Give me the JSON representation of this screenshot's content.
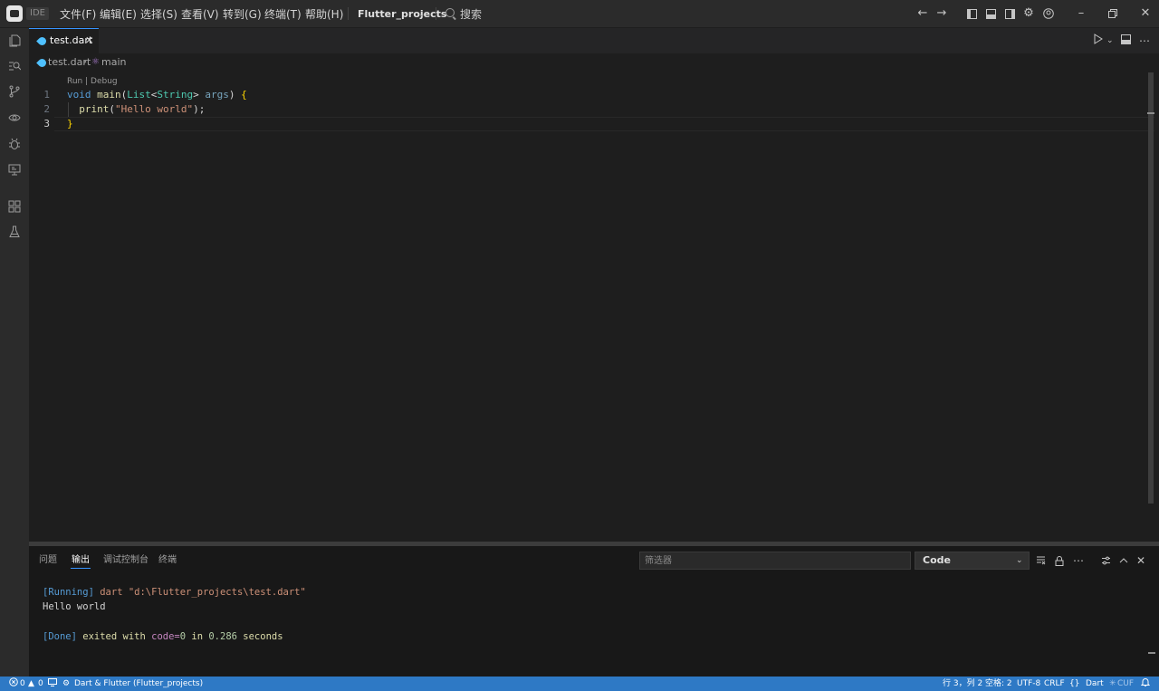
{
  "titlebar": {
    "ide_badge": "IDE",
    "menus": [
      "文件(F)",
      "编辑(E)",
      "选择(S)",
      "查看(V)",
      "转到(G)",
      "终端(T)",
      "帮助(H)"
    ],
    "project": "Flutter_projects",
    "search_label": "搜索"
  },
  "tab": {
    "label": "test.dart"
  },
  "breadcrumb": {
    "file": "test.dart",
    "symbol": "main"
  },
  "editor": {
    "codelens": "Run | Debug",
    "line_numbers": [
      "1",
      "2",
      "3"
    ],
    "lines": [
      {
        "t1": "void",
        "t2": " ",
        "t3": "main",
        "t4": "(",
        "t5": "List",
        "t6": "<",
        "t7": "String",
        "t8": "> ",
        "t9": "args",
        "t10": ") ",
        "t11": "{"
      },
      {
        "t1": "  ",
        "t2": "print",
        "t3": "(",
        "t4": "\"Hello world\"",
        "t5": ");"
      },
      {
        "t1": "}"
      }
    ]
  },
  "panel": {
    "tabs": [
      "问题",
      "输出",
      "调试控制台",
      "终端"
    ],
    "filter_placeholder": "筛选器",
    "channel": "Code",
    "output": {
      "l1a": "[Running]",
      "l1b": " dart ",
      "l1c": "\"d:\\Flutter_projects\\test.dart\"",
      "l2": "Hello world",
      "l3a": "[Done]",
      "l3b": " exited with ",
      "l3c": "code=",
      "l3d": "0",
      "l3e": " in ",
      "l3f": "0.286",
      "l3g": " seconds"
    }
  },
  "statusbar": {
    "errors": "0",
    "warnings": "0",
    "project": "Dart & Flutter (Flutter_projects)",
    "position": "行 3，列 2",
    "spaces": "空格: 2",
    "encoding": "UTF-8",
    "eol": "CRLF",
    "braces": "{}",
    "language": "Dart",
    "extra": "CUF"
  }
}
